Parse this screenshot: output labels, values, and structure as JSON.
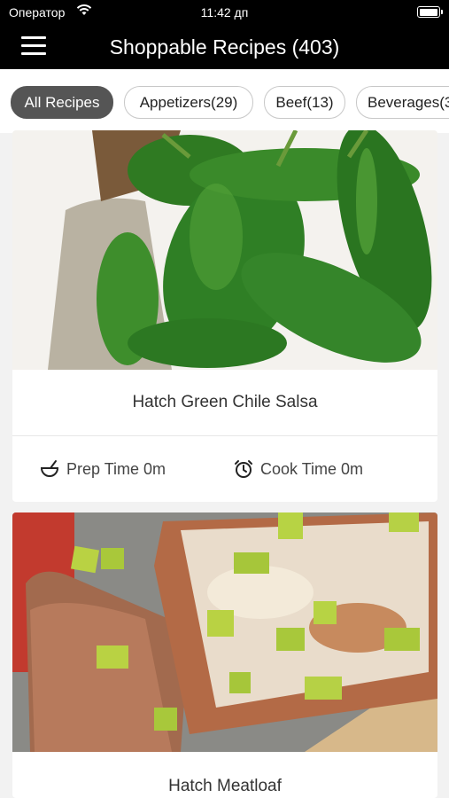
{
  "status_bar": {
    "carrier": "Оператор",
    "time": "11:42 дп",
    "battery_level": 0.9
  },
  "header": {
    "title": "Shoppable Recipes (403)"
  },
  "categories": [
    {
      "label": "All Recipes",
      "active": true
    },
    {
      "label": "Appetizers(29)",
      "active": false
    },
    {
      "label": "Beef(13)",
      "active": false
    },
    {
      "label": "Beverages(3",
      "active": false
    }
  ],
  "recipes": [
    {
      "name": "Hatch Green Chile Salsa",
      "prep_time": "Prep Time 0m",
      "cook_time": "Cook Time 0m",
      "photo": "green-chile-peppers-photo"
    },
    {
      "name": "Hatch Meatloaf",
      "photo": "meatloaf-photo"
    }
  ],
  "colors": {
    "header_bg": "#000000",
    "active_chip": "#555555",
    "background": "#f2f2f2"
  }
}
